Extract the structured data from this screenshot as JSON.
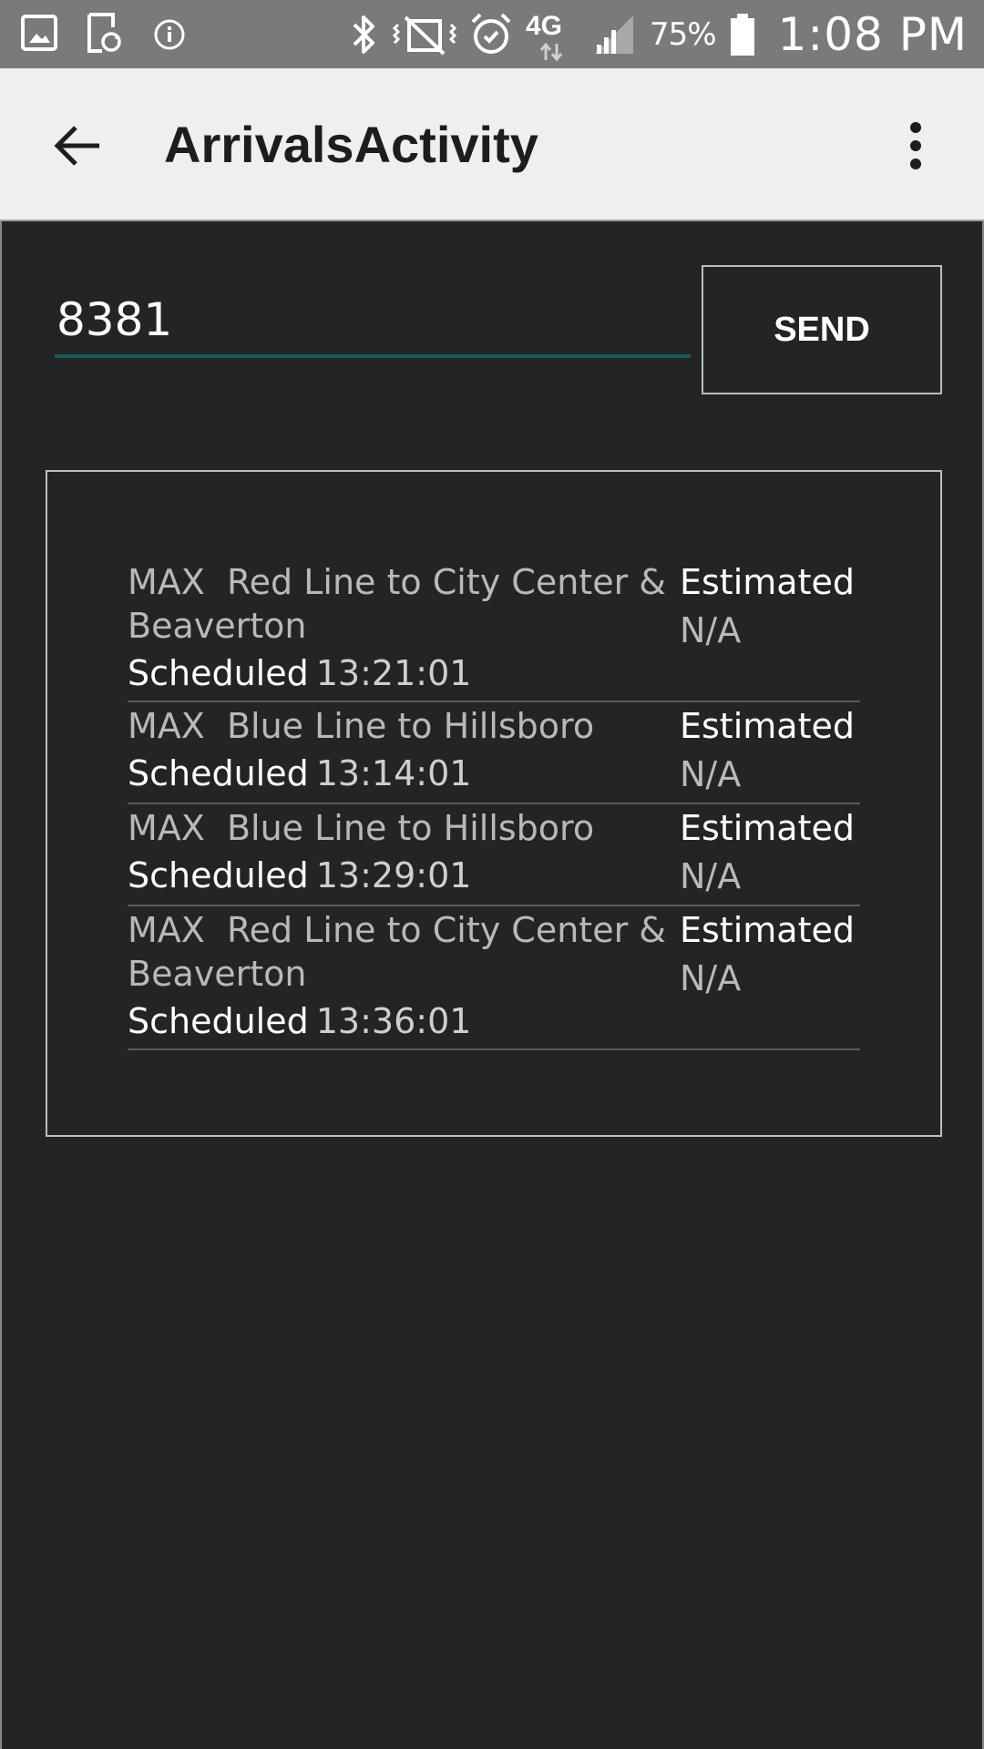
{
  "status_bar": {
    "network_label": "4G",
    "battery_percent": "75%",
    "time": "1:08 PM"
  },
  "app_bar": {
    "title": "ArrivalsActivity"
  },
  "stop_input": {
    "value": "8381"
  },
  "send_button": {
    "label": "SEND"
  },
  "colors": {
    "status_bar_bg": "#7a7a7a",
    "app_bar_bg": "#efefef",
    "content_bg": "#242424",
    "input_underline": "#1c5a58"
  },
  "arrivals": [
    {
      "route": "MAX  Red Line to City Center &\nBeaverton",
      "scheduled_label": "Scheduled",
      "scheduled_time": "13:21:01",
      "estimated_label": "Estimated",
      "estimated_value": "N/A"
    },
    {
      "route": "MAX  Blue Line to Hillsboro",
      "scheduled_label": "Scheduled",
      "scheduled_time": "13:14:01",
      "estimated_label": "Estimated",
      "estimated_value": "N/A"
    },
    {
      "route": "MAX  Blue Line to Hillsboro",
      "scheduled_label": "Scheduled",
      "scheduled_time": "13:29:01",
      "estimated_label": "Estimated",
      "estimated_value": "N/A"
    },
    {
      "route": "MAX  Red Line to City Center &\nBeaverton",
      "scheduled_label": "Scheduled",
      "scheduled_time": "13:36:01",
      "estimated_label": "Estimated",
      "estimated_value": "N/A"
    }
  ]
}
